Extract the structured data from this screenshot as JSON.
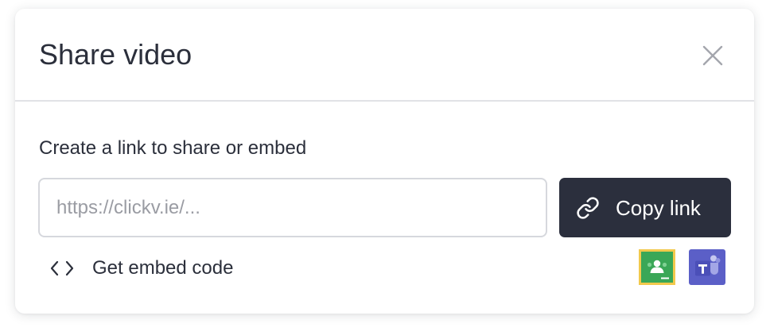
{
  "dialog": {
    "title": "Share video",
    "close_icon": "close-icon"
  },
  "share": {
    "section_label": "Create a link to share or embed",
    "link_value": "",
    "link_placeholder": "https://clickv.ie/...",
    "copy_button_label": "Copy link",
    "copy_icon": "link-icon",
    "embed_icon": "code-icon",
    "embed_label": "Get embed code"
  },
  "integrations": [
    {
      "name": "Google Classroom",
      "icon": "google-classroom-icon"
    },
    {
      "name": "Microsoft Teams",
      "icon": "microsoft-teams-icon"
    }
  ],
  "colors": {
    "primary_button": "#2b2f3d",
    "text": "#2b2f3b",
    "classroom_green": "#3aa757",
    "classroom_border": "#f2c94c",
    "teams_purple": "#5b5fc7"
  }
}
